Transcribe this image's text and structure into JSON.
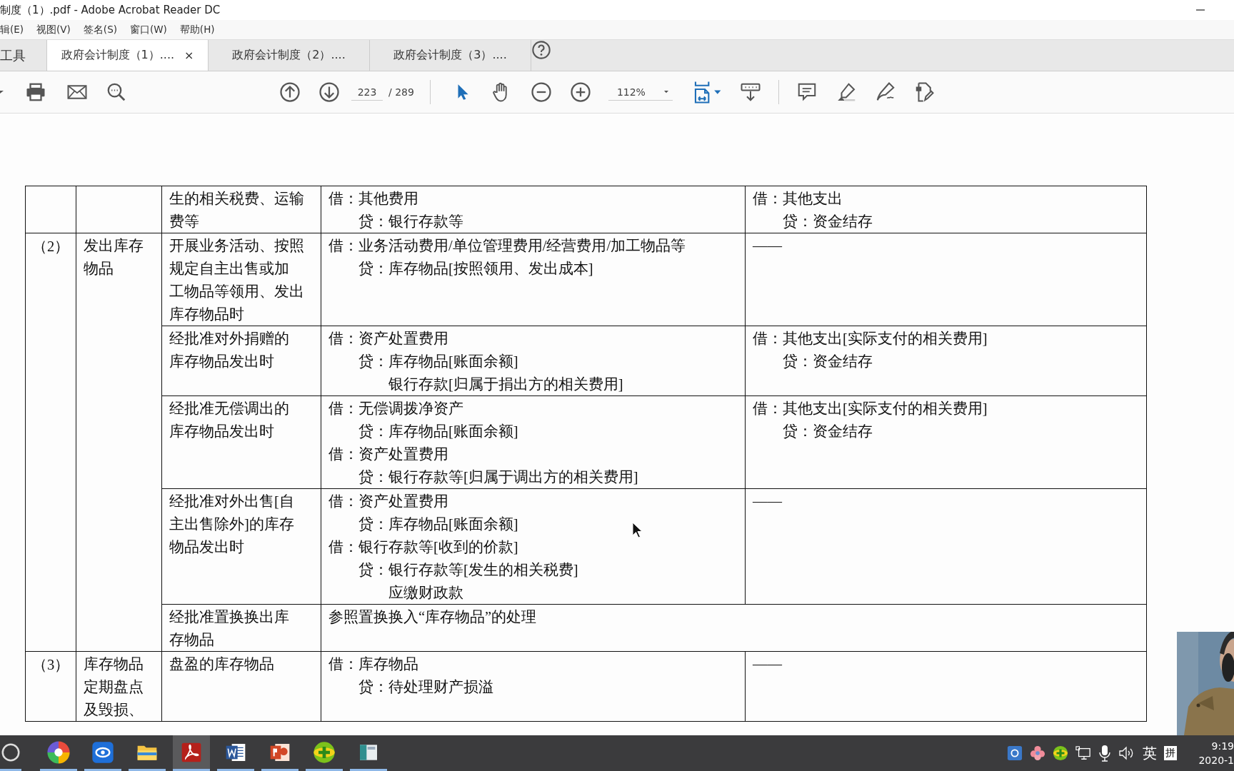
{
  "window": {
    "title": "制度（1）.pdf - Adobe Acrobat Reader DC"
  },
  "menu": [
    {
      "label": "辑(E)"
    },
    {
      "label": "视图(V)"
    },
    {
      "label": "签名(S)"
    },
    {
      "label": "窗口(W)"
    },
    {
      "label": "帮助(H)"
    }
  ],
  "tabs": [
    {
      "label": "工具",
      "selected": false
    },
    {
      "label": "政府会计制度（1）....",
      "selected": true,
      "close": "×"
    },
    {
      "label": "政府会计制度（2）....",
      "selected": false
    },
    {
      "label": "政府会计制度（3）....",
      "selected": false
    }
  ],
  "toolbar": {
    "page": "223",
    "page_count": "/ 289",
    "zoom": "112%",
    "tools": [
      {
        "kind": "select",
        "selected": true
      },
      {
        "kind": "hand",
        "selected": false
      }
    ]
  },
  "table": {
    "groups": [
      {
        "items": [
          {
            "kind": "entries",
            "situation": [
              "生的相关税费、运输",
              "费等"
            ],
            "financial": [
              {
                "kind": "debit",
                "text": "借：其他费用"
              },
              {
                "kind": "credit",
                "text": "贷：银行存款等"
              }
            ],
            "budget": [
              {
                "kind": "debit",
                "text": "借：其他支出"
              },
              {
                "kind": "credit",
                "text": "贷：资金结存"
              }
            ]
          }
        ]
      },
      {
        "number": "（2）",
        "category": [
          "发出库存",
          "物品"
        ],
        "items": [
          {
            "kind": "entries",
            "situation": [
              "开展业务活动、按照",
              "规定自主出售或加",
              "工物品等领用、发出",
              "库存物品时"
            ],
            "financial": [
              {
                "kind": "debit",
                "text": "借：业务活动费用/单位管理费用/经营费用/加工物品等"
              },
              {
                "kind": "credit",
                "text": "贷：库存物品[按照领用、发出成本]"
              }
            ],
            "budget": [
              {
                "kind": "debit",
                "text": "——"
              }
            ]
          },
          {
            "kind": "entries",
            "situation": [
              "经批准对外捐赠的",
              "库存物品发出时"
            ],
            "financial": [
              {
                "kind": "debit",
                "text": "借：资产处置费用"
              },
              {
                "kind": "credit",
                "text": "贷：库存物品[账面余额]"
              },
              {
                "kind": "continuation",
                "text": "银行存款[归属于捐出方的相关费用]"
              }
            ],
            "budget": [
              {
                "kind": "debit",
                "text": "借：其他支出[实际支付的相关费用]"
              },
              {
                "kind": "credit",
                "text": "贷：资金结存"
              }
            ]
          },
          {
            "kind": "entries",
            "situation": [
              "经批准无偿调出的",
              "库存物品发出时"
            ],
            "financial": [
              {
                "kind": "debit",
                "text": "借：无偿调拨净资产"
              },
              {
                "kind": "credit",
                "text": "贷：库存物品[账面余额]"
              },
              {
                "kind": "debit",
                "text": "借：资产处置费用"
              },
              {
                "kind": "credit",
                "text": "贷：银行存款等[归属于调出方的相关费用]"
              }
            ],
            "budget": [
              {
                "kind": "debit",
                "text": "借：其他支出[实际支付的相关费用]"
              },
              {
                "kind": "credit",
                "text": "贷：资金结存"
              }
            ]
          },
          {
            "kind": "entries",
            "situation": [
              "经批准对外出售[自",
              "主出售除外]的库存",
              "物品发出时"
            ],
            "financial": [
              {
                "kind": "debit",
                "text": "借：资产处置费用"
              },
              {
                "kind": "credit",
                "text": "贷：库存物品[账面余额]"
              },
              {
                "kind": "debit",
                "text": "借：银行存款等[收到的价款]"
              },
              {
                "kind": "credit",
                "text": "贷：银行存款等[发生的相关税费]"
              },
              {
                "kind": "continuation",
                "text": "应缴财政款"
              }
            ],
            "budget": [
              {
                "kind": "debit",
                "text": "——"
              }
            ]
          },
          {
            "kind": "reference",
            "situation": [
              "经批准置换换出库",
              "存物品"
            ],
            "note": "参照置换换入“库存物品”的处理"
          }
        ]
      },
      {
        "number": "（3）",
        "category": [
          "库存物品",
          "定期盘点",
          "及毁损、"
        ],
        "items": [
          {
            "kind": "entries",
            "situation": [
              "盘盈的库存物品"
            ],
            "financial": [
              {
                "kind": "debit",
                "text": "借：库存物品"
              },
              {
                "kind": "credit",
                "text": "贷：待处理财产损溢"
              }
            ],
            "budget": [
              {
                "kind": "debit",
                "text": "——"
              }
            ]
          }
        ]
      }
    ]
  },
  "taskbar": {
    "apps": [
      {
        "kind": "ring",
        "active": false
      },
      {
        "kind": "pinwheel",
        "active": false
      },
      {
        "kind": "eye",
        "active": false
      },
      {
        "kind": "folder",
        "active": false
      },
      {
        "kind": "pdf",
        "active": true
      },
      {
        "kind": "word",
        "active": false
      },
      {
        "kind": "slides",
        "active": false
      },
      {
        "kind": "plus",
        "active": false
      },
      {
        "kind": "window",
        "active": false
      }
    ],
    "tray": {
      "lang": "英",
      "ime": "拼",
      "time": "9:19",
      "date": "2020-1"
    }
  }
}
